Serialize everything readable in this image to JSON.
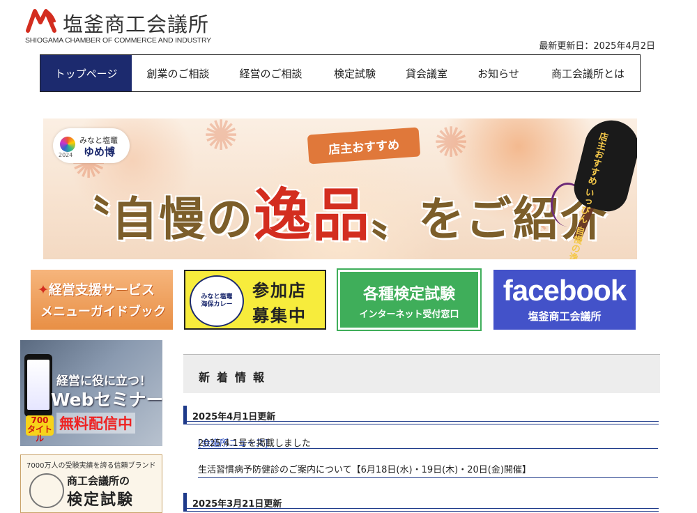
{
  "header": {
    "logo_jp": "塩釜商工会議所",
    "logo_en": "SHIOGAMA CHAMBER OF COMMERCE AND INDUSTRY",
    "updated": "最新更新日：2025年4月2日"
  },
  "nav": {
    "items": [
      {
        "label": "トップページ"
      },
      {
        "label": "創業のご相談"
      },
      {
        "label": "経営のご相談"
      },
      {
        "label": "検定試験"
      },
      {
        "label": "貸会議室"
      },
      {
        "label": "お知らせ"
      },
      {
        "label": "商工会議所とは"
      }
    ]
  },
  "hero": {
    "badge_small": "みなと塩竈",
    "badge_big": "ゆめ博",
    "badge_year": "2024",
    "tag": "店主おすすめ",
    "title_pre": "〝自慢の",
    "title_red": "逸品",
    "title_post": "〟をご紹介",
    "paddle": "店主おすすめ いっぴん 自慢の逸品"
  },
  "banners": {
    "b1_l1": "経営支援サービス",
    "b1_l2": "メニューガイドブック",
    "b2_seal": "みなと塩竈 海保カレー",
    "b2_r1": "参加店",
    "b2_r2": "募集中",
    "b3_l1": "各種検定試験",
    "b3_l2": "インターネット受付窓口",
    "b4_l1": "facebook",
    "b4_l2": "塩釜商工会議所"
  },
  "side": {
    "web_l1": "経営に役に立つ！",
    "web_l2": "Webセミナー",
    "web_badge": "700 タイトル",
    "web_l3": "無料配信中",
    "exam_top": "7000万人の受験実績を誇る信頼ブランド",
    "exam_l1": "商工会議所の",
    "exam_l2": "検定試験"
  },
  "news": {
    "heading": "新着情報",
    "groups": [
      {
        "date": "2025年4月1日更新",
        "items": [
          {
            "category": "[会議所ニュース]",
            "text": "2025.4.1号を掲載しました"
          },
          {
            "category": "",
            "text": "生活習慣病予防健診のご案内について【6月18日(水)・19日(木)・20日(金)開催】"
          }
        ]
      },
      {
        "date": "2025年3月21日更新",
        "items": []
      }
    ]
  },
  "colors": {
    "nav_active": "#1c2a6e",
    "accent_blue": "#1e3a8a",
    "facebook": "#4352c9",
    "green": "#3fae5a",
    "orange": "#e88f45"
  }
}
